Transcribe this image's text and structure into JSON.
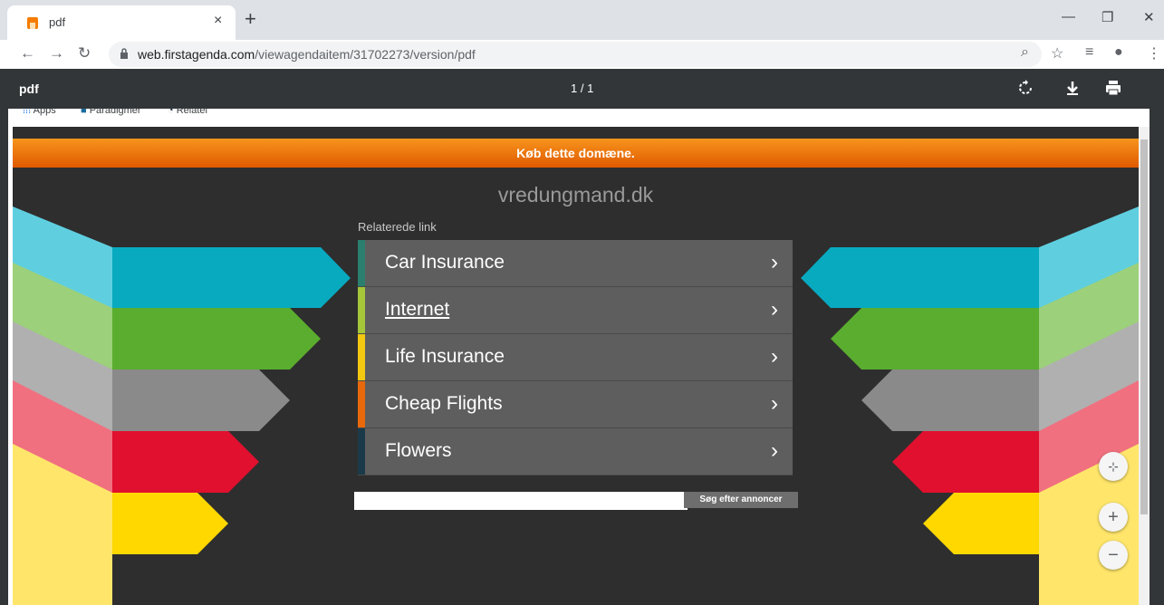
{
  "browser": {
    "tab_title": "pdf",
    "tab_close": "×",
    "new_tab": "+",
    "minimize": "—",
    "restore": "❐",
    "close": "✕",
    "url_host": "web.firstagenda.com",
    "url_path": "/viewagendaitem/31702273/version/pdf"
  },
  "pdf_viewer": {
    "title": "pdf",
    "page_indicator": "1 / 1"
  },
  "bookmarks": [
    "Apps",
    "Paradigmer",
    "Relatel"
  ],
  "site": {
    "banner": "Køb dette domæne.",
    "domain": "vredungmand.dk",
    "related_label": "Relaterede link",
    "links": [
      {
        "label": "Car Insurance",
        "accent": "#2a7f6e"
      },
      {
        "label": "Internet",
        "accent": "#a6c63a"
      },
      {
        "label": "Life Insurance",
        "accent": "#f2c811"
      },
      {
        "label": "Cheap Flights",
        "accent": "#e8690c"
      },
      {
        "label": "Flowers",
        "accent": "#1a3a4a"
      }
    ],
    "chevron": "›",
    "search_button": "Søg efter annoncer"
  },
  "colors": {
    "banner_orange": "#f08010",
    "teal": "#08aac0",
    "green": "#5aad2e",
    "grey": "#8a8a8a",
    "red": "#e0102e",
    "yellow": "#ffd800"
  }
}
